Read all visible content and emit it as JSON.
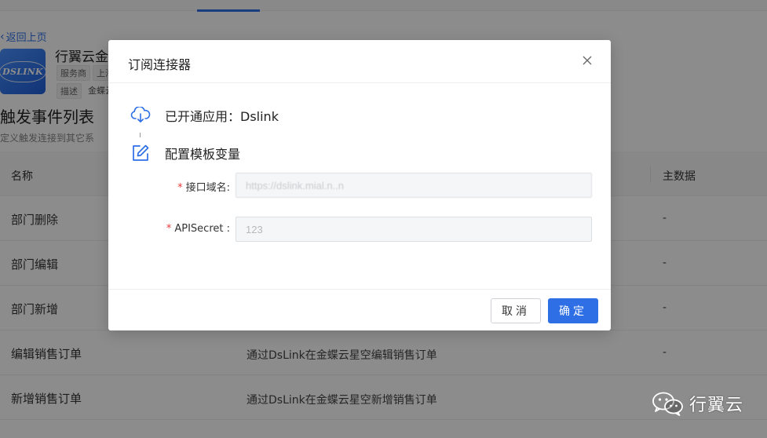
{
  "background": {
    "back_link": "返回上页",
    "app_name": "行翼云金蝶",
    "app_logo_text": "DSLINK",
    "tags": [
      "服务商",
      "上海",
      "描述",
      "金蝶云"
    ],
    "section_title": "触发事件列表",
    "section_subtitle": "定义触发连接到其它系",
    "table": {
      "columns": [
        "名称",
        "主数据"
      ],
      "rows": [
        {
          "name": "部门删除",
          "desc": "",
          "master": "-"
        },
        {
          "name": "部门编辑",
          "desc": "",
          "master": "-"
        },
        {
          "name": "部门新增",
          "desc": "",
          "master": "-"
        },
        {
          "name": "编辑销售订单",
          "desc": "通过DsLink在金蝶云星空编辑销售订单",
          "master": "-"
        },
        {
          "name": "新增销售订单",
          "desc": "通过DsLink在金蝶云星空新增销售订单",
          "master": ""
        }
      ]
    }
  },
  "modal": {
    "title": "订阅连接器",
    "close_icon": "close-icon",
    "steps": [
      {
        "icon": "cloud-download-icon",
        "text": "已开通应用：Dslink"
      },
      {
        "icon": "edit-icon",
        "text": "配置模板变量"
      }
    ],
    "fields": [
      {
        "label": "接口域名:",
        "value": "https://dslink.mial.n..n",
        "required": true
      },
      {
        "label": "APISecret :",
        "value": "123",
        "required": true
      }
    ],
    "cancel_label": "取消",
    "ok_label": "确定"
  },
  "watermark": {
    "text": "行翼云",
    "icon": "wechat-icon"
  },
  "colors": {
    "primary": "#2f6fe6",
    "required": "#e6393b",
    "overlay": "rgba(0,0,0,0.45)"
  }
}
